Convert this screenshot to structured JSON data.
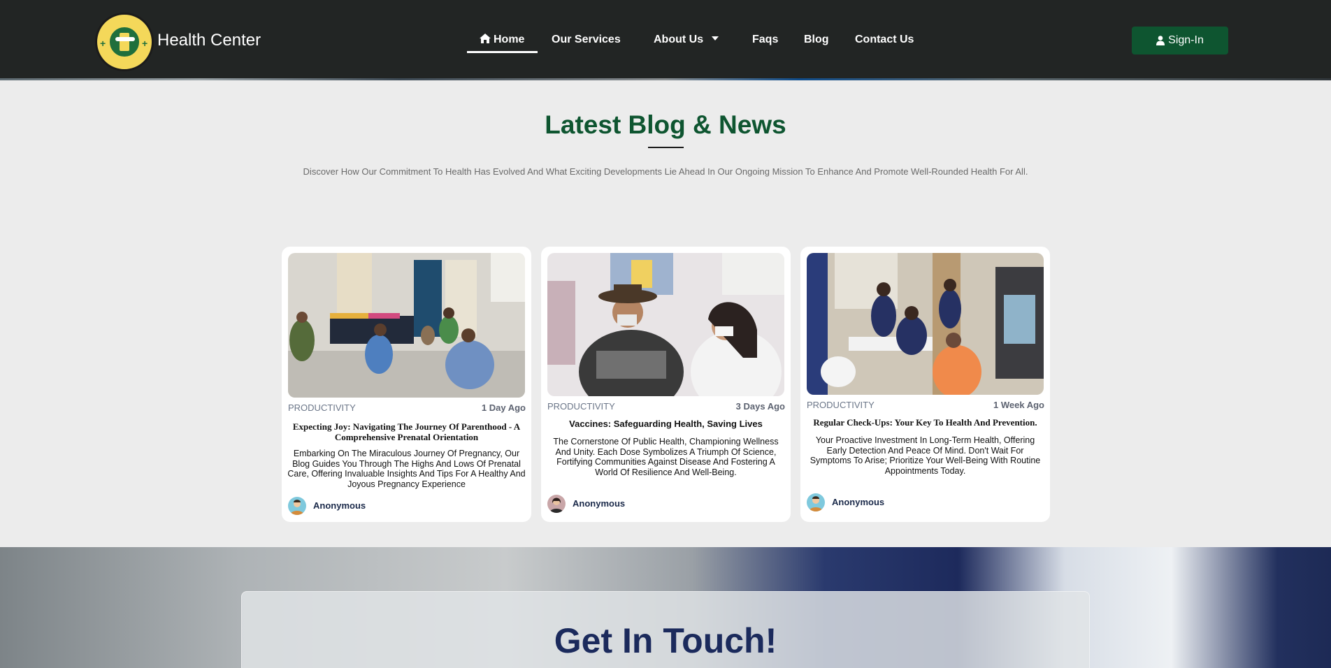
{
  "header": {
    "brand": "Health Center",
    "logo_icon": "clinic-logo-icon",
    "nav": {
      "home": "Home",
      "services": "Our Services",
      "about": "About Us",
      "faqs": "Faqs",
      "blog": "Blog",
      "contact": "Contact Us"
    },
    "signin": "Sign-In"
  },
  "blog_section": {
    "title": "Latest Blog & News",
    "subtitle": "Discover How Our Commitment To Health Has Evolved And What Exciting Developments Lie Ahead In Our Ongoing Mission To Enhance And Promote Well-Rounded Health For All.",
    "cards": [
      {
        "category": "PRODUCTIVITY",
        "time": "1 Day Ago",
        "title": "Expecting Joy: Navigating The Journey Of Parenthood - A Comprehensive Prenatal Orientation",
        "text": "Embarking On The Miraculous Journey Of Pregnancy, Our Blog Guides You Through The Highs And Lows Of Prenatal Care, Offering Invaluable Insights And Tips For A Healthy And Joyous Pregnancy Experience",
        "author": "Anonymous"
      },
      {
        "category": "PRODUCTIVITY",
        "time": "3 Days Ago",
        "title": "Vaccines: Safeguarding Health, Saving Lives",
        "text": "The Cornerstone Of Public Health, Championing Wellness And Unity. Each Dose Symbolizes A Triumph Of Science, Fortifying Communities Against Disease And Fostering A World Of Resilience And Well-Being.",
        "author": "Anonymous"
      },
      {
        "category": "PRODUCTIVITY",
        "time": "1 Week Ago",
        "title": "Regular Check-Ups: Your Key To Health And Prevention.",
        "text": "Your Proactive Investment In Long-Term Health, Offering Early Detection And Peace Of Mind. Don't Wait For Symptoms To Arise; Prioritize Your Well-Being With Routine Appointments Today.",
        "author": "Anonymous"
      }
    ]
  },
  "contact_section": {
    "title": "Get In Touch!"
  },
  "colors": {
    "navbar": "#222524",
    "brand_green": "#0e5530",
    "contact_navy": "#1b2a5c"
  }
}
